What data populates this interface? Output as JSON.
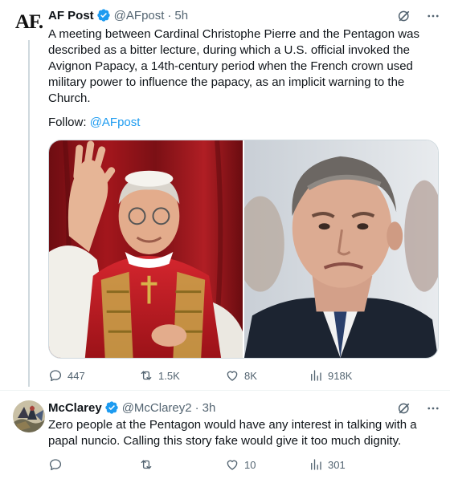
{
  "main_tweet": {
    "avatar_text": "AF.",
    "name": "AF Post",
    "handle": "@AFpost",
    "separator": "·",
    "time": "5h",
    "text": "A meeting between Cardinal Christophe Pierre and the Pentagon was described as a bitter lecture, during which a U.S. official invoked the Avignon Papacy, a 14th-century period when the French crown used military power to influence the papacy, as an implicit warning to the Church.",
    "follow_label": "Follow:",
    "follow_link": "@AFpost",
    "media_left": "Cardinal in red vestments waving",
    "media_right": "Man in suit looking upward",
    "stats": {
      "replies": "447",
      "reposts": "1.5K",
      "likes": "8K",
      "views": "918K"
    }
  },
  "reply_tweet": {
    "name": "McClarey",
    "handle": "@McClarey2",
    "separator": "·",
    "time": "3h",
    "text": "Zero people at the Pentagon would have any interest in talking with a papal nuncio.  Calling this story fake would give it too much dignity.",
    "stats": {
      "replies": "",
      "reposts": "",
      "likes": "10",
      "views": "301"
    }
  },
  "colors": {
    "text": "#0f1419",
    "secondary": "#536471",
    "accent": "#1d9bf0",
    "border": "#cfd9de"
  },
  "icons": [
    "verified-badge-icon",
    "grok-icon",
    "more-icon",
    "reply-icon",
    "repost-icon",
    "like-icon",
    "views-icon",
    "bookmark-icon",
    "share-icon"
  ]
}
